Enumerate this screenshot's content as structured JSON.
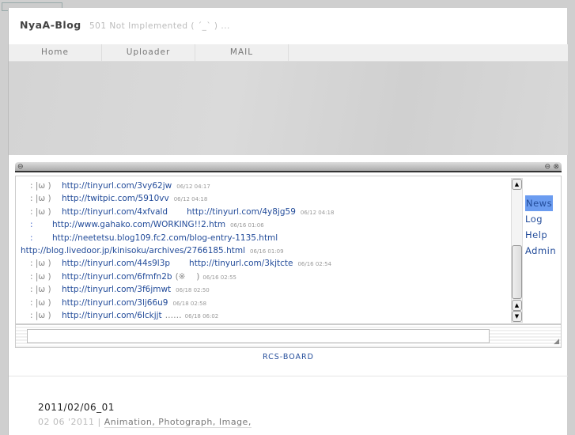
{
  "header": {
    "title": "NyaA-Blog",
    "subtitle": "501 Not Implemented ( ´_` ) ..."
  },
  "nav": [
    {
      "label": "Home"
    },
    {
      "label": "Uploader"
    },
    {
      "label": "MAIL"
    }
  ],
  "chat": {
    "lines": [
      {
        "prefix": ": |ω )",
        "links": [
          "http://tinyurl.com/3vy62jw"
        ],
        "time": "06/12 04:17"
      },
      {
        "prefix": ": |ω )",
        "links": [
          "http://twitpic.com/5910vv"
        ],
        "time": "06/12 04:18"
      },
      {
        "prefix": ": |ω )",
        "links": [
          "http://tinyurl.com/4xfvald",
          "http://tinyurl.com/4y8jg59"
        ],
        "time": "06/12 04:18"
      },
      {
        "prefix": ":",
        "links": [
          "http://www.gahako.com/WORKING!!2.htm"
        ],
        "time": "06/16 01:06"
      },
      {
        "prefix": ":",
        "links": [
          "http://neetetsu.blog109.fc2.com/blog-entry-1135.html"
        ],
        "time": ""
      },
      {
        "prefix": "",
        "links": [
          "http://blog.livedoor.jp/kinisoku/archives/2766185.html"
        ],
        "time": "06/16 01:09"
      },
      {
        "prefix": ": |ω )",
        "links": [
          "http://tinyurl.com/44s9l3p",
          "http://tinyurl.com/3kjtcte"
        ],
        "time": "06/16 02:54"
      },
      {
        "prefix": ": |ω )",
        "links": [
          "http://tinyurl.com/6fmfn2b"
        ],
        "suffix": "(※　 )",
        "time": "06/16 02:55"
      },
      {
        "prefix": ": |ω )",
        "links": [
          "http://tinyurl.com/3f6jmwt"
        ],
        "time": "06/18 02:50"
      },
      {
        "prefix": ": |ω )",
        "links": [
          "http://tinyurl.com/3lj66u9"
        ],
        "time": "06/18 02:58"
      },
      {
        "prefix": ": |ω )",
        "links": [
          "http://tinyurl.com/6lckjjt"
        ],
        "suffix": "……",
        "time": "06/18 06:02"
      }
    ],
    "menu": [
      {
        "label": "News",
        "selected": true
      },
      {
        "label": "Log"
      },
      {
        "label": "Help"
      },
      {
        "label": "Admin"
      }
    ],
    "input_value": "",
    "footer_link": "RCS-BOARD"
  },
  "post": {
    "title": "2011/02/06_01",
    "date": "02 06 '2011",
    "separator": "|",
    "categories": "Animation, Photograph, Image,"
  }
}
